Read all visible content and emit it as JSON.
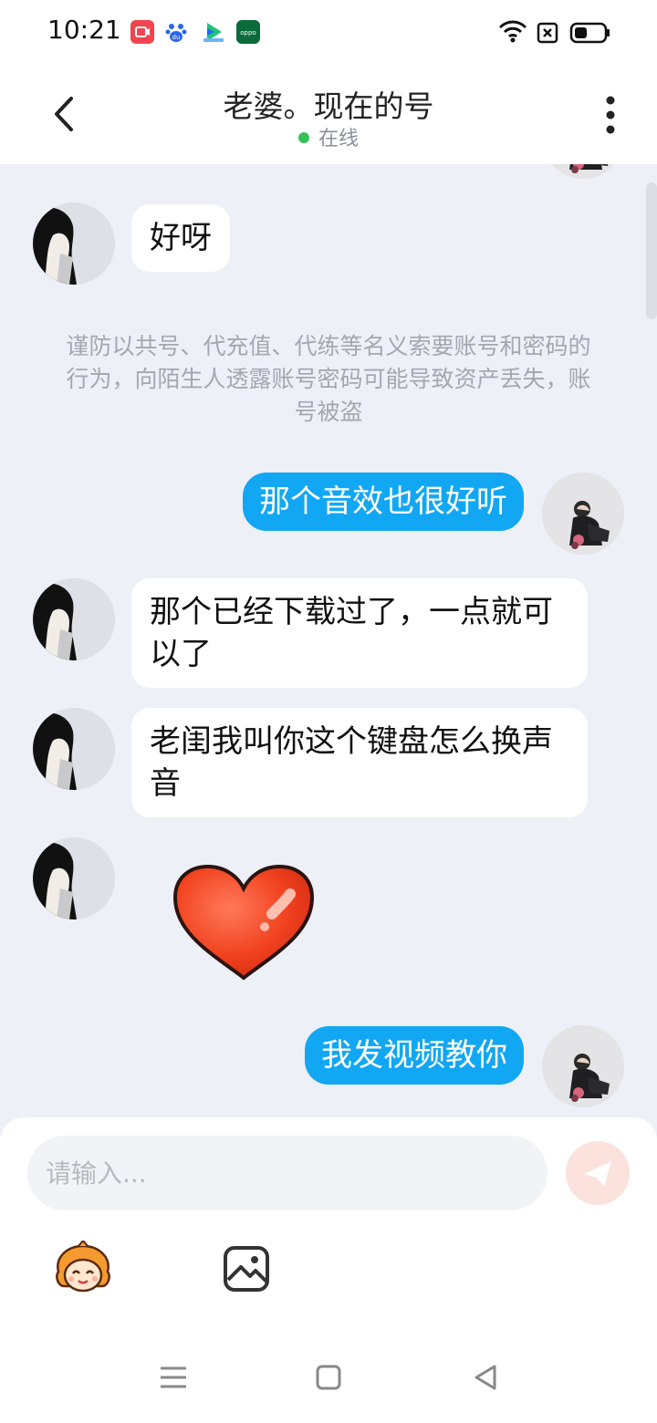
{
  "status_bar": {
    "time": "10:21",
    "app_icons": [
      {
        "name": "screen-record-icon",
        "color": "#f0454f"
      },
      {
        "name": "baidu-paw-icon",
        "color": "#2b65e6"
      },
      {
        "name": "video-play-icon",
        "color": "#25c07a"
      },
      {
        "name": "oppo-icon",
        "color": "#0c6b3b"
      }
    ],
    "right_icons": [
      "wifi-icon",
      "no-sim-icon",
      "battery-icon"
    ]
  },
  "header": {
    "title": "老婆。现在的号",
    "status": "在线",
    "status_color": "#35c05a"
  },
  "messages": [
    {
      "side": "in",
      "type": "text",
      "text": "好呀"
    },
    {
      "side": "system",
      "type": "notice",
      "text": "谨防以共号、代充值、代练等名义索要账号和密码的行为，向陌生人透露账号密码可能导致资产丢失，账号被盗"
    },
    {
      "side": "out",
      "type": "text",
      "text": "那个音效也很好听"
    },
    {
      "side": "in",
      "type": "text",
      "text": "那个已经下载过了，一点就可以了"
    },
    {
      "side": "in",
      "type": "text",
      "text": "老闺我叫你这个键盘怎么换声音"
    },
    {
      "side": "in",
      "type": "sticker",
      "sticker": "heart-sticker"
    },
    {
      "side": "out",
      "type": "text",
      "text": "我发视频教你"
    }
  ],
  "composer": {
    "placeholder": "请输入...",
    "send_icon": "send-icon",
    "tools": [
      "emoji-sticker-icon",
      "image-icon"
    ]
  },
  "colors": {
    "outgoing_bubble": "#12a7f3",
    "incoming_bubble": "#ffffff",
    "chat_background": "#eef0f7"
  },
  "nav": [
    "menu-icon",
    "home-icon",
    "back-icon"
  ]
}
